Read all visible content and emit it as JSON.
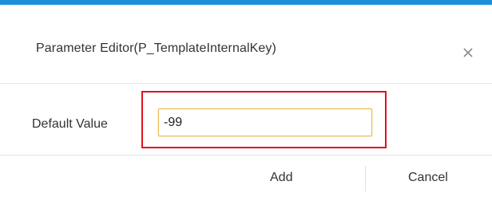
{
  "dialog": {
    "title": "Parameter Editor(P_TemplateInternalKey)",
    "close_icon": "close-icon"
  },
  "form": {
    "default_value_label": "Default Value",
    "default_value": "-99"
  },
  "footer": {
    "add_label": "Add",
    "cancel_label": "Cancel"
  },
  "colors": {
    "accent": "#1e8fdb",
    "highlight": "#e3101c",
    "input_focus_border": "#e8b94f"
  }
}
